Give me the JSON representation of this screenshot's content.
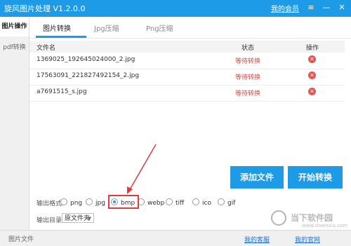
{
  "titlebar": {
    "title": "旋风图片处理 V1.2.0.0",
    "member_link": "我的会员",
    "window_buttons": {
      "menu": "≡",
      "minimize": "—",
      "close": "✕"
    }
  },
  "sidebar": {
    "items": [
      {
        "label": "图片操作"
      },
      {
        "label": "pdf转换"
      }
    ]
  },
  "tabs": [
    {
      "label": "图片转换"
    },
    {
      "label": "Jpg压缩"
    },
    {
      "label": "Png压缩"
    }
  ],
  "table": {
    "headers": {
      "filename": "文件名",
      "status": "状态",
      "action": "操作"
    },
    "rows": [
      {
        "filename": "1369025_192645024000_2.jpg",
        "status": "等待转换"
      },
      {
        "filename": "17563091_221827492154_2.jpg",
        "status": "等待转换"
      },
      {
        "filename": "a7691515_s.jpg",
        "status": "等待转换"
      }
    ]
  },
  "actions": {
    "add_file": "添加文件",
    "start_convert": "开始转换"
  },
  "output": {
    "format_label": "输出格式:",
    "formats": [
      "png",
      "jpg",
      "bmp",
      "webp",
      "tiff",
      "ico",
      "gif"
    ],
    "selected_format": "bmp",
    "dir_label": "输出目录:",
    "dir_value": "原文件夹"
  },
  "footer": {
    "left_text": "图片文件",
    "link_customer_service": "我的客服",
    "link_website": "我的官网"
  },
  "watermark": {
    "text": "当下软件园",
    "url": "www.downxia.com"
  },
  "colors": {
    "accent": "#1e9be6",
    "status": "#e04a4a",
    "delete": "#e8534f",
    "annotation": "#e23a3a"
  }
}
